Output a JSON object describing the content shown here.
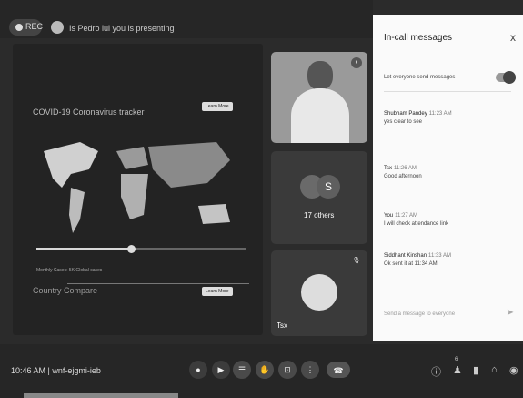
{
  "topbar": {
    "rec_label": "REC",
    "presenter_text": "Is Pedro lui you is presenting"
  },
  "share": {
    "title": "COVID-19 Coronavirus tracker",
    "button_a": "Learn More",
    "button_b": "Learn More",
    "caption": "Monthly Cases: 5K Global cases",
    "subtitle": "Country Compare",
    "timeline_progress": 0.45
  },
  "tiles": {
    "video_name": "",
    "others_initial": "S",
    "others_label": "17 others",
    "tsx_label": "Tsx"
  },
  "chat": {
    "title": "In-call messages",
    "close": "x",
    "toggle_label": "Let everyone send messages",
    "messages": [
      {
        "name": "Shubham Pandey",
        "time": "11:23 AM",
        "text": "yes clear to see"
      },
      {
        "name": "Tsx",
        "time": "11:26 AM",
        "text": "Good afternoon"
      },
      {
        "name": "You",
        "time": "11:27 AM",
        "text": "I will check attendance link"
      },
      {
        "name": "Siddhant Kinshan",
        "time": "11:33 AM",
        "text": "Ok sent it at 11:34 AM"
      }
    ],
    "input_placeholder": "Send a message to everyone"
  },
  "bottombar": {
    "time_code": "10:46 AM | wnf-ejgmi-ieb",
    "badge": "6"
  },
  "colors": {
    "background": "#2b2b2b",
    "panel": "#fafafa"
  }
}
